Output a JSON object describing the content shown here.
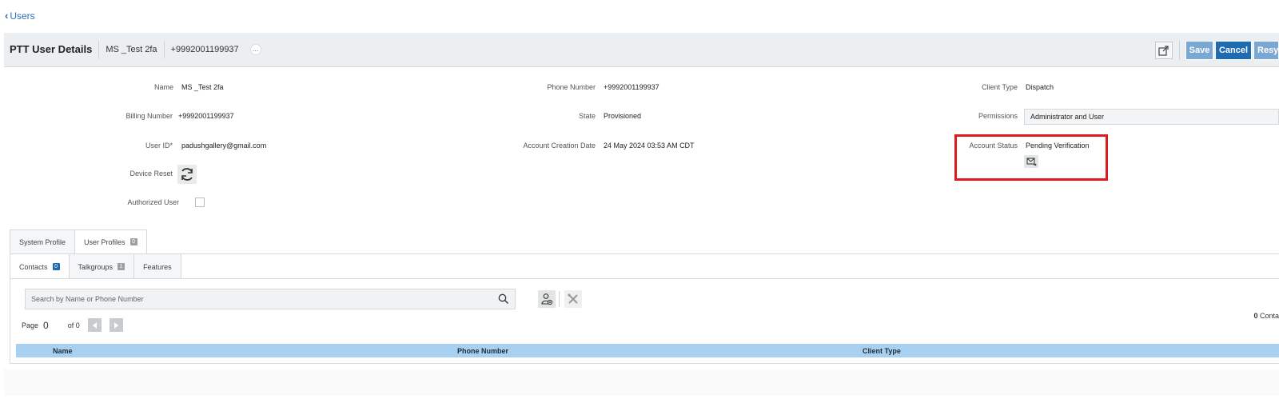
{
  "nav": {
    "back_label": "Users"
  },
  "header": {
    "title": "PTT User Details",
    "user_name": "MS _Test 2fa",
    "phone": "+9992001199937",
    "more": "...",
    "save_label": "Save",
    "cancel_label": "Cancel",
    "resend_label": "Resy"
  },
  "details": {
    "name_label": "Name",
    "name_value": "MS _Test 2fa",
    "billing_label": "Billing Number",
    "billing_value": "+9992001199937",
    "userid_label": "User ID*",
    "userid_value": "padushgallery@gmail.com",
    "device_reset_label": "Device Reset",
    "authorized_label": "Authorized User",
    "phone_label": "Phone Number",
    "phone_value": "+9992001199937",
    "state_label": "State",
    "state_value": "Provisioned",
    "creation_label": "Account Creation Date",
    "creation_value": "24 May 2024 03:53 AM CDT",
    "client_type_label": "Client Type",
    "client_type_value": "Dispatch",
    "permissions_label": "Permissions",
    "permissions_value": "Administrator and User",
    "account_status_label": "Account Status",
    "account_status_value": "Pending Verification"
  },
  "profile_tabs": [
    {
      "label": "System Profile"
    },
    {
      "label": "User Profiles",
      "badge": "0"
    }
  ],
  "sub_tabs": [
    {
      "label": "Contacts",
      "badge": "0"
    },
    {
      "label": "Talkgroups",
      "badge": "1"
    },
    {
      "label": "Features"
    }
  ],
  "contacts": {
    "search_placeholder": "Search by Name or Phone Number",
    "page_label": "Page",
    "page_value": "0",
    "of_label": "of 0",
    "count_value": "0",
    "count_label": "Conta",
    "columns": [
      "Name",
      "Phone Number",
      "Client Type"
    ]
  },
  "colors": {
    "accent": "#1f6bb0",
    "header_bg": "#eceff1",
    "table_header": "#a8d1f1",
    "highlight": "#e0191f"
  }
}
